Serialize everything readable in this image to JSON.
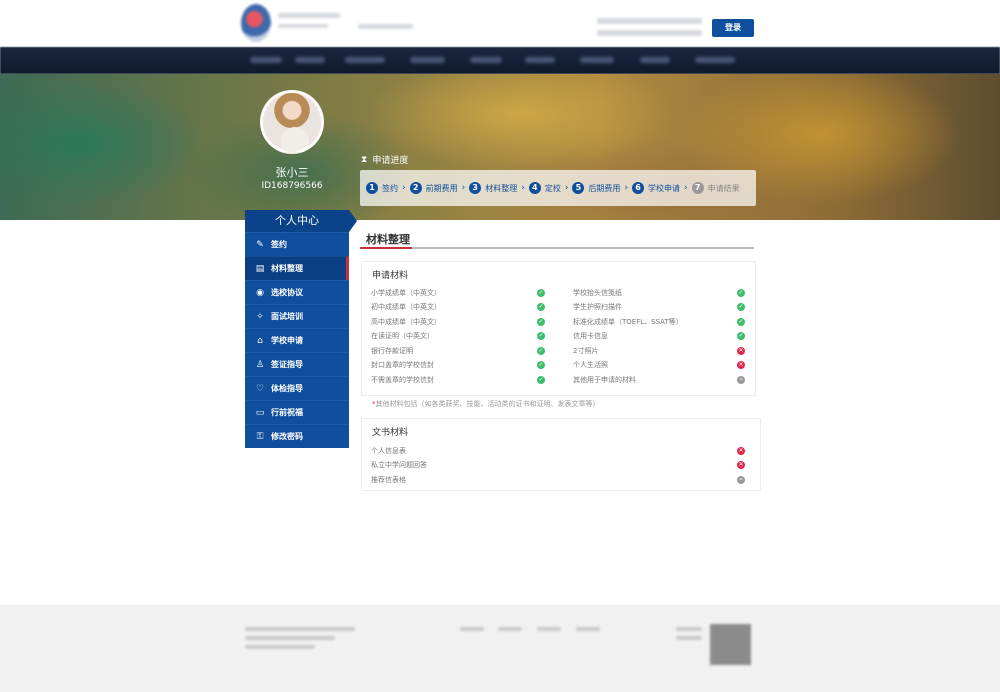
{
  "header": {
    "login_label": "登录"
  },
  "profile": {
    "name": "张小三",
    "id": "ID168796566"
  },
  "progress": {
    "title": "申请进度",
    "steps": [
      {
        "num": "1",
        "label": "签约"
      },
      {
        "num": "2",
        "label": "前期费用"
      },
      {
        "num": "3",
        "label": "材料整理"
      },
      {
        "num": "4",
        "label": "定校"
      },
      {
        "num": "5",
        "label": "后期费用"
      },
      {
        "num": "6",
        "label": "学校申请"
      },
      {
        "num": "7",
        "label": "申请结果"
      }
    ]
  },
  "sidebar": {
    "title": "个人中心",
    "items": [
      {
        "label": "签约",
        "icon": "edit-icon"
      },
      {
        "label": "材料整理",
        "icon": "document-icon"
      },
      {
        "label": "选校协议",
        "icon": "agreement-icon"
      },
      {
        "label": "面试培训",
        "icon": "interview-icon"
      },
      {
        "label": "学校申请",
        "icon": "school-icon"
      },
      {
        "label": "签证指导",
        "icon": "user-icon"
      },
      {
        "label": "体检指导",
        "icon": "health-icon"
      },
      {
        "label": "行前祝福",
        "icon": "message-icon"
      },
      {
        "label": "修改密码",
        "icon": "lock-icon"
      }
    ]
  },
  "content": {
    "title": "材料整理",
    "application_materials": {
      "title": "申请材料",
      "left": [
        {
          "label": "小学成绩单（中英文）",
          "status": "ok"
        },
        {
          "label": "初中成绩单（中英文）",
          "status": "ok"
        },
        {
          "label": "高中成绩单（中英文）",
          "status": "ok"
        },
        {
          "label": "在读证明（中英文）",
          "status": "ok"
        },
        {
          "label": "银行存款证明",
          "status": "ok"
        },
        {
          "label": "封口盖章的学校信封",
          "status": "ok"
        },
        {
          "label": "不需盖章的学校信封",
          "status": "ok"
        }
      ],
      "right": [
        {
          "label": "学校抬头信笺纸",
          "status": "ok"
        },
        {
          "label": "学生护照扫描件",
          "status": "ok"
        },
        {
          "label": "标准化成绩单（TOEFL、SSAT等）",
          "status": "ok"
        },
        {
          "label": "信用卡信息",
          "status": "ok"
        },
        {
          "label": "2寸照片",
          "status": "no"
        },
        {
          "label": "个人生活照",
          "status": "no"
        },
        {
          "label": "其他用于申请的材料",
          "status": "pending"
        }
      ]
    },
    "note_star": "*",
    "note": "其他材料包括（如各类获奖、技能、活动类的证书和证明、发表文章等）",
    "documents": {
      "title": "文书材料",
      "items": [
        {
          "label": "个人信息表",
          "status": "no"
        },
        {
          "label": "私立中学问题回答",
          "status": "no"
        },
        {
          "label": "推荐信表格",
          "status": "pending"
        }
      ]
    }
  },
  "colors": {
    "primary": "#0f4f9e",
    "accent_red": "#c7323a",
    "ok": "#3ebd6c",
    "no": "#e0284a",
    "pending": "#9a9a9a"
  }
}
